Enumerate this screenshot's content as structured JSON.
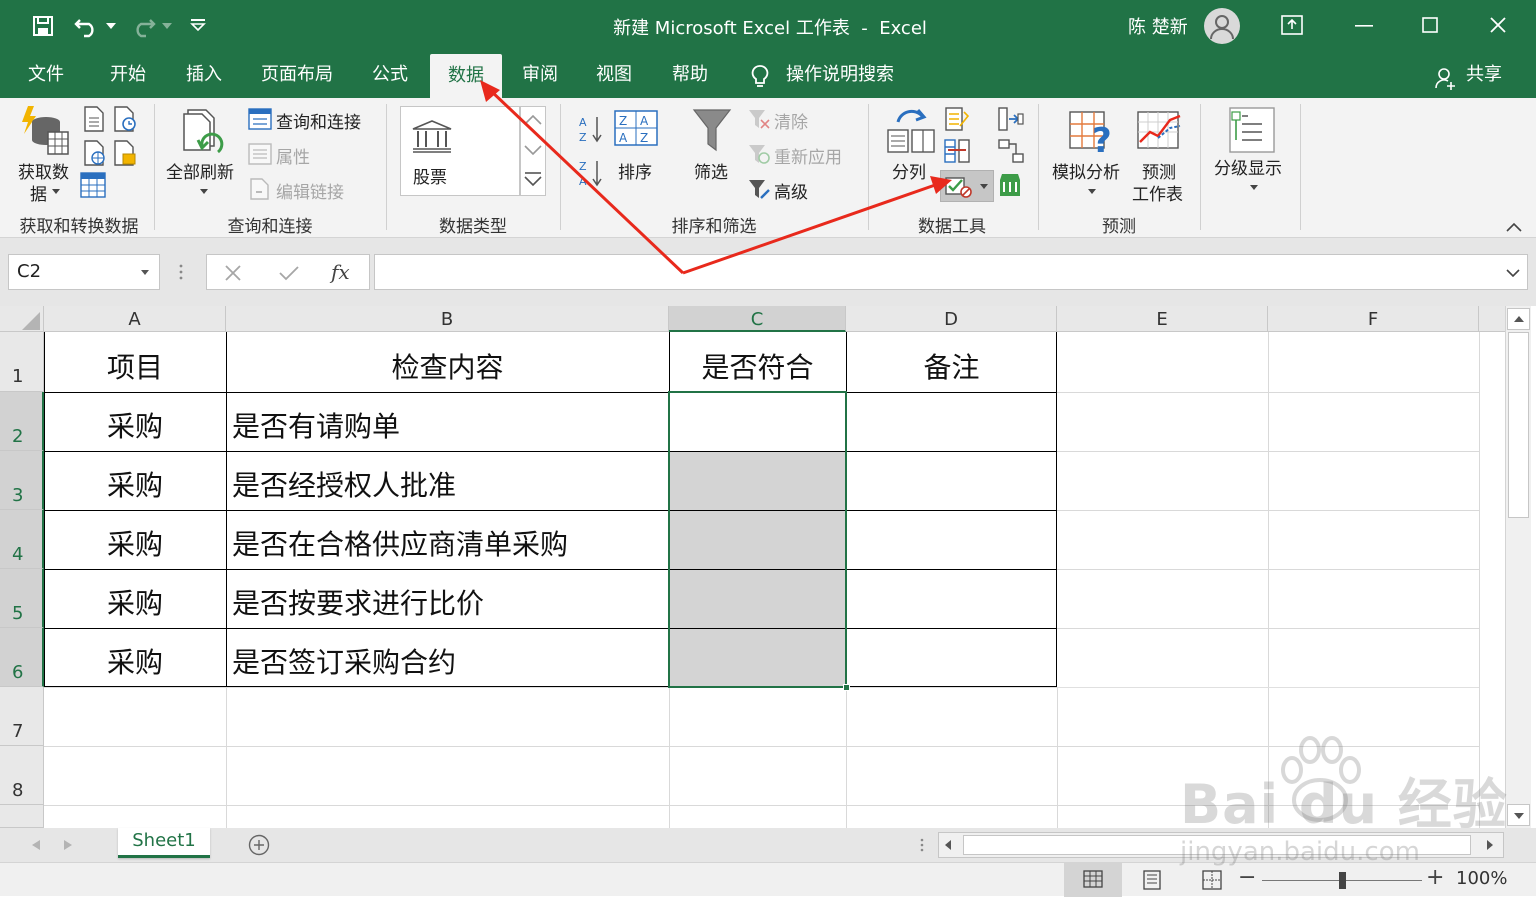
{
  "window": {
    "title": "新建 Microsoft Excel 工作表  -  Excel",
    "user_name": "陈 楚新"
  },
  "tabs": [
    "文件",
    "开始",
    "插入",
    "页面布局",
    "公式",
    "数据",
    "审阅",
    "视图",
    "帮助"
  ],
  "active_tab": "数据",
  "tell_me": "操作说明搜索",
  "share": "共享",
  "ribbon": {
    "get_data": {
      "label_line1": "获取数",
      "label_line2": "据",
      "group": "获取和转换数据"
    },
    "queries": {
      "refresh_line1": "全部刷新",
      "queries_connections": "查询和连接",
      "properties": "属性",
      "edit_links": "编辑链接",
      "group": "查询和连接"
    },
    "data_types": {
      "stocks": "股票",
      "group": "数据类型"
    },
    "sort_filter": {
      "sort": "排序",
      "filter": "筛选",
      "clear": "清除",
      "reapply": "重新应用",
      "advanced": "高级",
      "group": "排序和筛选"
    },
    "data_tools": {
      "text_to_columns": "分列",
      "group": "数据工具"
    },
    "forecast": {
      "what_if_line1": "模拟分析",
      "forecast_line1": "预测",
      "forecast_line2": "工作表",
      "group": "预测"
    },
    "outline": {
      "label": "分级显示"
    }
  },
  "formula_bar": {
    "name_box": "C2",
    "fx": "fx",
    "value": ""
  },
  "grid": {
    "columns": [
      "A",
      "B",
      "C",
      "D",
      "E",
      "F"
    ],
    "selected_column": "C",
    "rows": [
      "1",
      "2",
      "3",
      "4",
      "5",
      "6",
      "7",
      "8"
    ],
    "cells": {
      "header": [
        "项目",
        "检查内容",
        "是否符合",
        "备注"
      ],
      "r2": [
        "采购",
        "是否有请购单"
      ],
      "r3": [
        "采购",
        "是否经授权人批准"
      ],
      "r4": [
        "采购",
        "是否在合格供应商清单采购"
      ],
      "r5": [
        "采购",
        "是否按要求进行比价"
      ],
      "r6": [
        "采购",
        "是否签订采购合约"
      ]
    }
  },
  "sheet_tabs": [
    "Sheet1"
  ],
  "status": {
    "zoom": "100%"
  },
  "watermark": {
    "line1": "Bai du 经验",
    "line2": "jingyan.baidu.com"
  },
  "colors": {
    "excel_green": "#217346",
    "annotation_arrow": "#e8291c",
    "selection_fill": "#d4d4d4"
  }
}
